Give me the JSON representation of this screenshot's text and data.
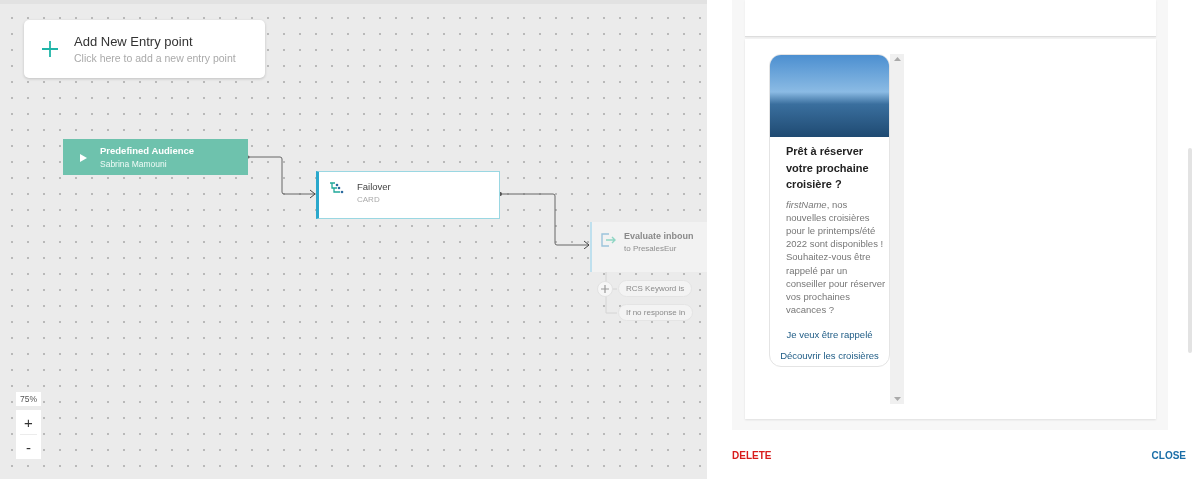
{
  "add_entry": {
    "title": "Add New Entry point",
    "subtitle": "Click here to add a new entry point"
  },
  "nodes": [
    {
      "kind": "entry",
      "title": "Predefined Audience",
      "subtitle": "Sabrina Mamouni"
    },
    {
      "kind": "card",
      "title": "Failover",
      "subtitle": "CARD"
    },
    {
      "kind": "evaluate",
      "title": "Evaluate inboun",
      "subtitle": "to PresalesEur",
      "branches": [
        "RCS Keyword is",
        "If no response in"
      ]
    }
  ],
  "zoom": {
    "level_label": "75%",
    "zoom_in": "+",
    "zoom_out": "-"
  },
  "rich_card": {
    "title": "Prêt à réserver votre prochaine croisière ?",
    "body": "*firstName*, nos nouvelles croisières pour le printemps/été 2022 sont disponibles ! Souhaitez-vous être rappelé par un conseiller pour réserver vos prochaines vacances ?",
    "suggestions": [
      "Je veux être rappelé",
      "Découvrir les croisières"
    ]
  },
  "actions": {
    "delete": "DELETE",
    "close": "CLOSE"
  }
}
